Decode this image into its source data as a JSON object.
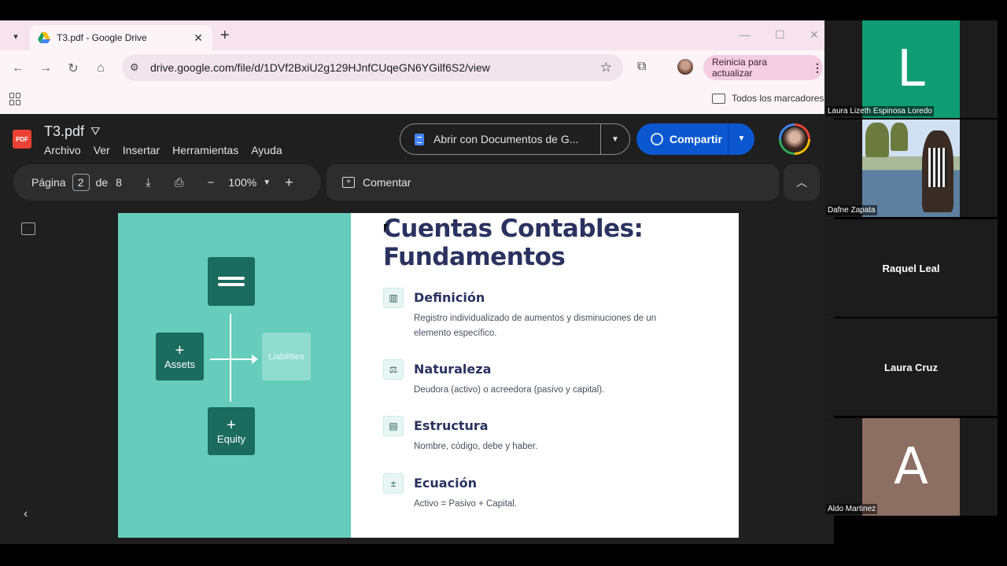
{
  "browser": {
    "tab_title": "T3.pdf - Google Drive",
    "url": "drive.google.com/file/d/1DVf2BxiU2g129HJnfCUqeGN6YGilf6S2/view",
    "update_label": "Reinicia para actualizar",
    "bookmarks_label": "Todos los marcadores"
  },
  "drive": {
    "doc_title": "T3.pdf",
    "pdf_badge": "PDF",
    "menus": [
      "Archivo",
      "Ver",
      "Insertar",
      "Herramientas",
      "Ayuda"
    ],
    "open_with_label": "Abrir con Documentos de G...",
    "share_label": "Compartir",
    "page_label": "Página",
    "page_current": "2",
    "page_of": "de",
    "page_total": "8",
    "zoom": "100%",
    "comment_label": "Comentar"
  },
  "slide": {
    "title_line1": "Cuentas Contables:",
    "title_line2": "Fundamentos",
    "diagram": {
      "assets": "Assets",
      "liabilities": "Liabilities",
      "equity": "Equity",
      "plus": "+"
    },
    "items": [
      {
        "heading": "Definición",
        "text": "Registro individualizado de aumentos y disminuciones de un elemento específico.",
        "icon": "list-icon"
      },
      {
        "heading": "Naturaleza",
        "text": "Deudora (activo) o acreedora (pasivo y capital).",
        "icon": "scale-icon"
      },
      {
        "heading": "Estructura",
        "text": "Nombre, código, debe y haber.",
        "icon": "structure-icon"
      },
      {
        "heading": "Ecuación",
        "text": "Activo = Pasivo + Capital.",
        "icon": "calculator-icon"
      }
    ]
  },
  "participants": [
    {
      "name": "Laura Lizeth Espinosa Loredo",
      "initial": "L",
      "color": "#0f9d74"
    },
    {
      "name": "Dafne Zapata"
    },
    {
      "name": "Raquel Leal"
    },
    {
      "name": "Laura Cruz"
    },
    {
      "name": "Aldo Martinez",
      "initial": "A",
      "color": "#8d6e63"
    }
  ]
}
